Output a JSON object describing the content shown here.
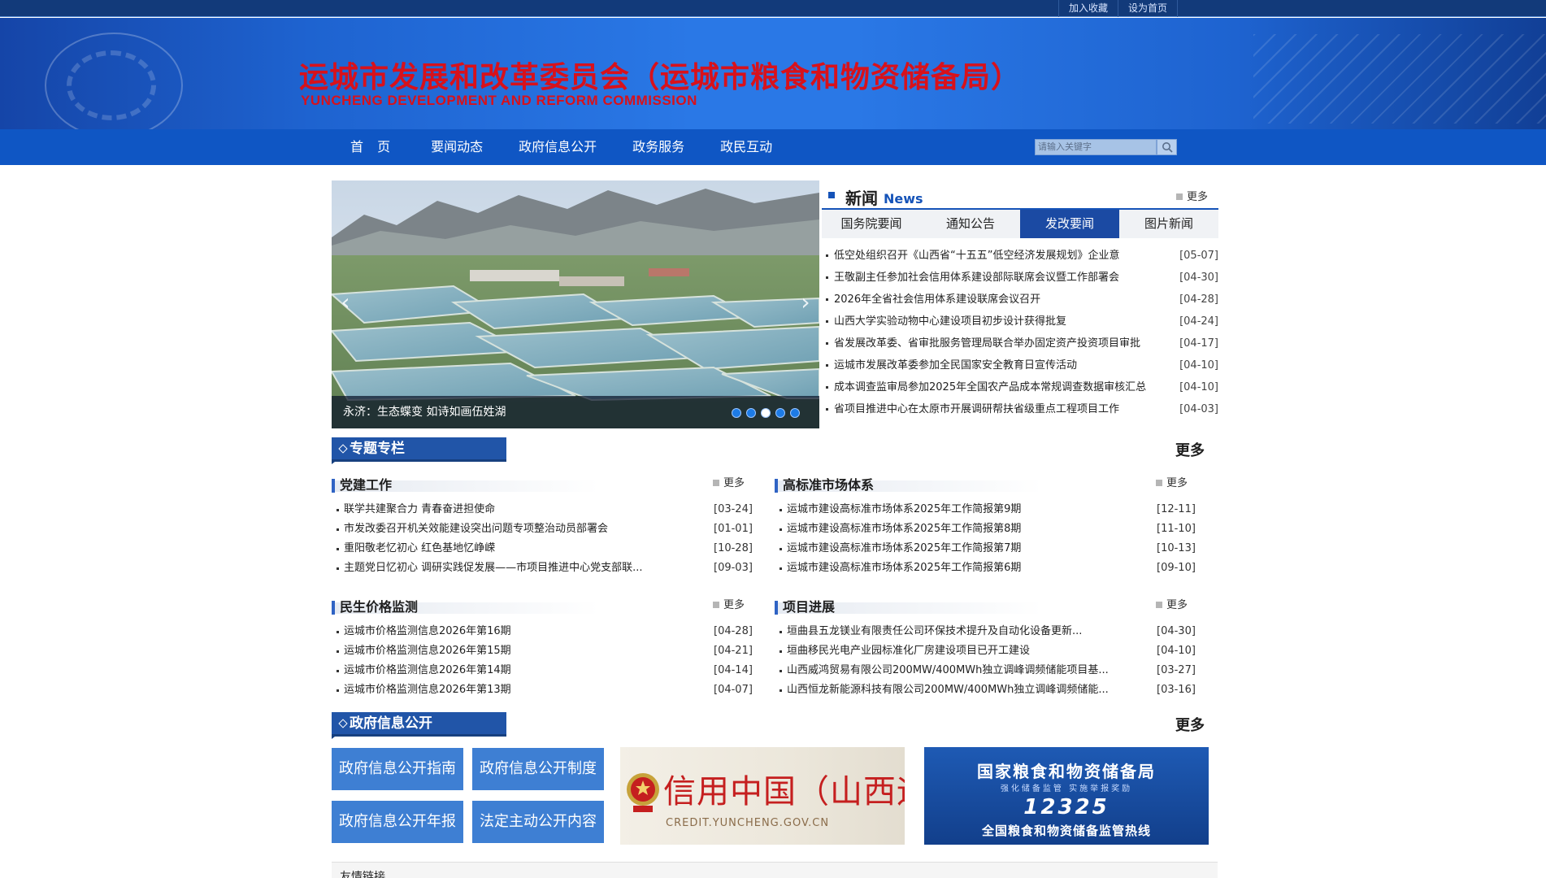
{
  "topbar": {
    "links": [
      "加入收藏",
      "设为首页"
    ]
  },
  "header": {
    "title_cn": "运城市发展和改革委员会（运城市粮食和物资储备局）",
    "title_en": "YUNCHENG DEVELOPMENT AND REFORM COMMISSION"
  },
  "nav": {
    "items": [
      "首 页",
      "要闻动态",
      "政府信息公开",
      "政务服务",
      "政民互动"
    ],
    "search_placeholder": "请输入关键字"
  },
  "slider": {
    "caption": "永济：生态蝶变 如诗如画伍姓湖",
    "dot_count": 5,
    "active_dot": 3
  },
  "news": {
    "title_cn": "新闻",
    "title_en": "News",
    "more": "更多",
    "tabs": [
      "国务院要闻",
      "通知公告",
      "发改要闻",
      "图片新闻"
    ],
    "active_tab": 2,
    "items": [
      {
        "title": "低空处组织召开《山西省“十五五”低空经济发展规划》企业意",
        "date": "[05-07]"
      },
      {
        "title": "王敬副主任参加社会信用体系建设部际联席会议暨工作部署会",
        "date": "[04-30]"
      },
      {
        "title": "2026年全省社会信用体系建设联席会议召开",
        "date": "[04-28]"
      },
      {
        "title": "山西大学实验动物中心建设项目初步设计获得批复",
        "date": "[04-24]"
      },
      {
        "title": "省发展改革委、省审批服务管理局联合举办固定资产投资项目审批",
        "date": "[04-17]"
      },
      {
        "title": "运城市发展改革委参加全民国家安全教育日宣传活动",
        "date": "[04-10]"
      },
      {
        "title": "成本调查监审局参加2025年全国农产品成本常规调查数据审核汇总",
        "date": "[04-10]"
      },
      {
        "title": "省项目推进中心在太原市开展调研帮扶省级重点工程项目工作",
        "date": "[04-03]"
      }
    ]
  },
  "special": {
    "label": "专题专栏",
    "more": "更多",
    "columns": [
      {
        "name": "党建工作",
        "more": "更多",
        "items": [
          {
            "title": "联学共建聚合力 青春奋进担使命",
            "date": "[03-24]"
          },
          {
            "title": "市发改委召开机关效能建设突出问题专项整治动员部署会",
            "date": "[01-01]"
          },
          {
            "title": "重阳敬老忆初心 红色基地忆峥嵘",
            "date": "[10-28]"
          },
          {
            "title": "主题党日忆初心 调研实践促发展——市项目推进中心党支部联...",
            "date": "[09-03]"
          }
        ]
      },
      {
        "name": "高标准市场体系",
        "more": "更多",
        "items": [
          {
            "title": "运城市建设高标准市场体系2025年工作简报第9期",
            "date": "[12-11]"
          },
          {
            "title": "运城市建设高标准市场体系2025年工作简报第8期",
            "date": "[11-10]"
          },
          {
            "title": "运城市建设高标准市场体系2025年工作简报第7期",
            "date": "[10-13]"
          },
          {
            "title": "运城市建设高标准市场体系2025年工作简报第6期",
            "date": "[09-10]"
          }
        ]
      },
      {
        "name": "民生价格监测",
        "more": "更多",
        "items": [
          {
            "title": "运城市价格监测信息2026年第16期",
            "date": "[04-28]"
          },
          {
            "title": "运城市价格监测信息2026年第15期",
            "date": "[04-21]"
          },
          {
            "title": "运城市价格监测信息2026年第14期",
            "date": "[04-14]"
          },
          {
            "title": "运城市价格监测信息2026年第13期",
            "date": "[04-07]"
          }
        ]
      },
      {
        "name": "项目进展",
        "more": "更多",
        "items": [
          {
            "title": "垣曲县五龙镁业有限责任公司环保技术提升及自动化设备更新...",
            "date": "[04-30]"
          },
          {
            "title": "垣曲移民光电产业园标准化厂房建设项目已开工建设",
            "date": "[04-10]"
          },
          {
            "title": "山西威鸿贸易有限公司200MW/400MWh独立调峰调频储能项目基...",
            "date": "[03-27]"
          },
          {
            "title": "山西恒龙新能源科技有限公司200MW/400MWh独立调峰调频储能...",
            "date": "[03-16]"
          }
        ]
      }
    ]
  },
  "govinfo": {
    "label": "政府信息公开",
    "more": "更多",
    "buttons": [
      "政府信息公开指南",
      "政府信息公开制度",
      "政府信息公开年报",
      "法定主动公开内容"
    ]
  },
  "credit_banner": {
    "title": "信用中国（山西运城）",
    "url": "CREDIT.YUNCHENG.GOV.CN"
  },
  "grain_banner": {
    "line1": "国家粮食和物资储备局",
    "line2": "强化储备监管  实施举报奖励",
    "line3": "12325",
    "line4": "全国粮食和物资储备监管热线"
  },
  "friendly_links": {
    "label": "友情链接"
  },
  "colors": {
    "nav": "#0f56c4",
    "accent": "#1b4aa3",
    "title_red": "#d8111b",
    "button_blue": "#3e7fd3"
  }
}
